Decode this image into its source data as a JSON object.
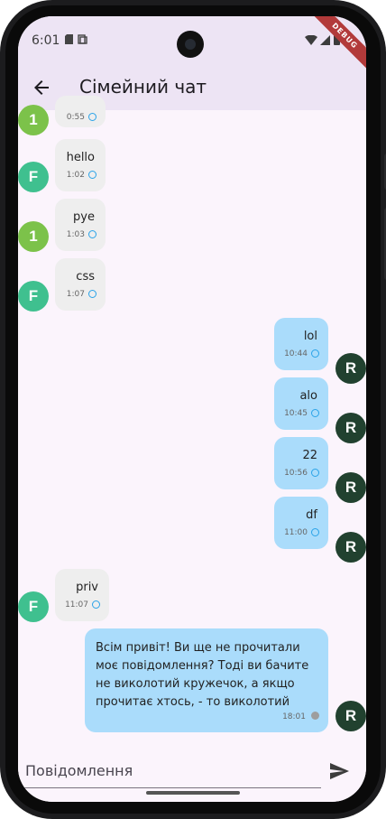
{
  "status_bar": {
    "time": "6:01",
    "debug_label": "DEBUG"
  },
  "app_bar": {
    "title": "Сімейний чат"
  },
  "messages": [
    {
      "sender": "1",
      "text": "",
      "time": "0:55",
      "direction": "in",
      "status": "ring"
    },
    {
      "sender": "F",
      "text": "hello",
      "time": "1:02",
      "direction": "in",
      "status": "ring"
    },
    {
      "sender": "1",
      "text": "pye",
      "time": "1:03",
      "direction": "in",
      "status": "ring"
    },
    {
      "sender": "F",
      "text": "css",
      "time": "1:07",
      "direction": "in",
      "status": "ring"
    },
    {
      "sender": "R",
      "text": "lol",
      "time": "10:44",
      "direction": "out",
      "status": "ring"
    },
    {
      "sender": "R",
      "text": "alo",
      "time": "10:45",
      "direction": "out",
      "status": "ring"
    },
    {
      "sender": "R",
      "text": "22",
      "time": "10:56",
      "direction": "out",
      "status": "ring"
    },
    {
      "sender": "R",
      "text": "df",
      "time": "11:00",
      "direction": "out",
      "status": "ring"
    },
    {
      "sender": "F",
      "text": "priv",
      "time": "11:07",
      "direction": "in",
      "status": "ring"
    },
    {
      "sender": "R",
      "text": "Всім привіт! Ви ще не прочитали моє повідомлення? Тоді ви бачите не виколотий кружечок, а якщо прочитає хтось, - то виколотий",
      "time": "18:01",
      "direction": "out",
      "status": "dot"
    }
  ],
  "composer": {
    "placeholder": "Повідомлення"
  },
  "colors": {
    "avatar_1": "#7cc24a",
    "avatar_F": "#3fc08f",
    "avatar_R": "#21412f",
    "bubble_in": "#eeeeee",
    "bubble_out": "#aadcfb",
    "read_ring": "#2aa3e8",
    "appbar": "#ede4f4"
  },
  "icons": [
    "back-arrow-icon",
    "send-icon",
    "wifi-icon",
    "signal-icon",
    "battery-icon",
    "sim-icon",
    "screenshot-icon"
  ]
}
